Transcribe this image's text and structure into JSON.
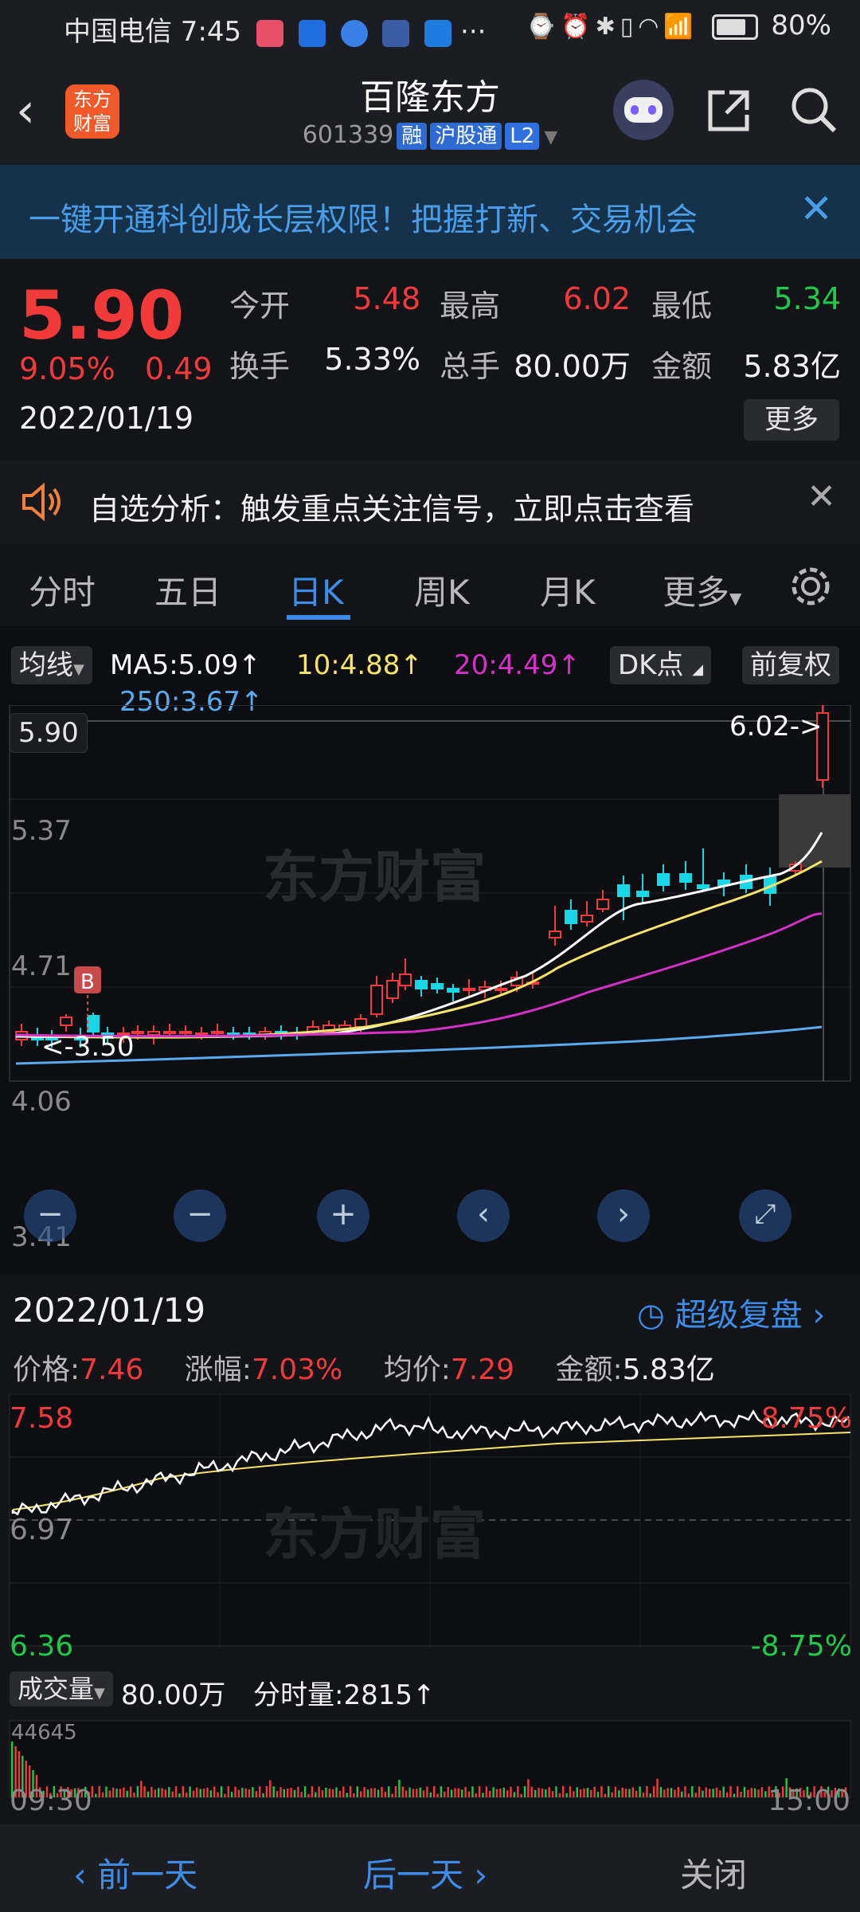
{
  "status_bar": {
    "carrier_time": "中国电信 7:45",
    "dots": "···",
    "battery": "80%"
  },
  "header": {
    "title": "百隆东方",
    "code": "601339",
    "tags": [
      "融",
      "沪股通",
      "L2"
    ],
    "logo": "东方\n财富"
  },
  "banner": {
    "text": "一键开通科创成长层权限！把握打新、交易机会"
  },
  "quote": {
    "price": "5.90",
    "change_pct": "9.05%",
    "change": "0.49",
    "date": "2022/01/19",
    "fields": [
      {
        "label": "今开",
        "value": "5.48",
        "color": "#f23a3a"
      },
      {
        "label": "最高",
        "value": "6.02",
        "color": "#f23a3a"
      },
      {
        "label": "最低",
        "value": "5.34",
        "color": "#1fc94a"
      },
      {
        "label": "换手",
        "value": "5.33%",
        "color": "#f2f2f2"
      },
      {
        "label": "总手",
        "value": "80.00万",
        "color": "#f2f2f2"
      },
      {
        "label": "金额",
        "value": "5.83亿",
        "color": "#f2f2f2"
      }
    ],
    "more": "更多"
  },
  "alert": {
    "text": "自选分析：触发重点关注信号，立即点击查看"
  },
  "tabs": [
    "分时",
    "五日",
    "日K",
    "周K",
    "月K",
    "更多"
  ],
  "active_tab": "日K",
  "kline": {
    "ma_selector": "均线",
    "ma5": "MA5:5.09↑",
    "ma10": "10:4.88↑",
    "ma20": "20:4.49↑",
    "ma250": "250:3.67↑",
    "dk_button": "DK点",
    "fq_button": "前复权",
    "current_price": "5.90",
    "max_label": "6.02->",
    "min_label": "<-3.50",
    "y_labels": [
      "5.37",
      "4.71",
      "4.06",
      "3.41"
    ],
    "b_marker": "B",
    "watermark": "东方财富",
    "colors": {
      "ma5": "#ffffff",
      "ma10": "#f5e36a",
      "ma20": "#d431c8",
      "ma250": "#5aaaf0",
      "up": "#f23a3a",
      "down": "#19d6e6"
    }
  },
  "intraday": {
    "date": "2022/01/19",
    "replay_label": "超级复盘",
    "price_label": "价格:",
    "price": "7.46",
    "chg_label": "涨幅:",
    "chg": "7.03%",
    "avg_label": "均价:",
    "avg": "7.29",
    "amount_label": "金额:",
    "amount": "5.83亿",
    "y_top": "7.58",
    "y_mid": "6.97",
    "y_bot": "6.36",
    "pct_top": "8.75%",
    "pct_bot": "-8.75%",
    "watermark": "东方财富",
    "vol_selector": "成交量",
    "vol_total": "80.00万",
    "vol_min": "分时量:2815↑",
    "vol_max": "44645",
    "time_start": "09:30",
    "time_end": "15:00"
  },
  "footer": {
    "prev": "前一天",
    "next": "后一天",
    "close": "关闭"
  }
}
